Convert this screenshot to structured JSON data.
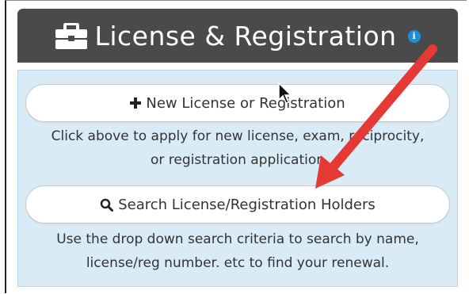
{
  "header": {
    "title": "License & Registration",
    "icon": "briefcase-icon",
    "info_icon": "info-icon",
    "info_glyph": "i",
    "background": "#4a4a4a"
  },
  "new_license": {
    "label": "New License or Registration",
    "icon": "plus-icon",
    "description": "Click above to apply for new license, exam, reciprocity,\nor registration application"
  },
  "search": {
    "label": "Search License/Registration Holders",
    "icon": "search-icon",
    "description": "Use the drop down search criteria to search by name,\nlicense/reg number. etc to find your renewal."
  },
  "colors": {
    "panel_body": "#d9ebf7",
    "annotation_arrow": "#e53935",
    "info_icon": "#1d8fd8"
  }
}
